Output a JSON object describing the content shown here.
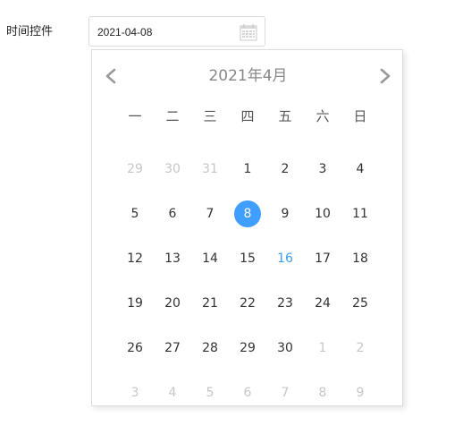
{
  "field": {
    "label": "时间控件",
    "value": "2021-04-08",
    "icon": "calendar-icon"
  },
  "picker": {
    "title": "2021年4月",
    "prev_icon": "chevron-left-icon",
    "next_icon": "chevron-right-icon",
    "weekdays": [
      "一",
      "二",
      "三",
      "四",
      "五",
      "六",
      "日"
    ],
    "weeks": [
      [
        {
          "d": "29",
          "s": "other"
        },
        {
          "d": "30",
          "s": "other"
        },
        {
          "d": "31",
          "s": "other"
        },
        {
          "d": "1",
          "s": ""
        },
        {
          "d": "2",
          "s": ""
        },
        {
          "d": "3",
          "s": ""
        },
        {
          "d": "4",
          "s": ""
        }
      ],
      [
        {
          "d": "5",
          "s": ""
        },
        {
          "d": "6",
          "s": ""
        },
        {
          "d": "7",
          "s": ""
        },
        {
          "d": "8",
          "s": "selected"
        },
        {
          "d": "9",
          "s": ""
        },
        {
          "d": "10",
          "s": ""
        },
        {
          "d": "11",
          "s": ""
        }
      ],
      [
        {
          "d": "12",
          "s": ""
        },
        {
          "d": "13",
          "s": ""
        },
        {
          "d": "14",
          "s": ""
        },
        {
          "d": "15",
          "s": ""
        },
        {
          "d": "16",
          "s": "today"
        },
        {
          "d": "17",
          "s": ""
        },
        {
          "d": "18",
          "s": ""
        }
      ],
      [
        {
          "d": "19",
          "s": ""
        },
        {
          "d": "20",
          "s": ""
        },
        {
          "d": "21",
          "s": ""
        },
        {
          "d": "22",
          "s": ""
        },
        {
          "d": "23",
          "s": ""
        },
        {
          "d": "24",
          "s": ""
        },
        {
          "d": "25",
          "s": ""
        }
      ],
      [
        {
          "d": "26",
          "s": ""
        },
        {
          "d": "27",
          "s": ""
        },
        {
          "d": "28",
          "s": ""
        },
        {
          "d": "29",
          "s": ""
        },
        {
          "d": "30",
          "s": ""
        },
        {
          "d": "1",
          "s": "other"
        },
        {
          "d": "2",
          "s": "other"
        }
      ],
      [
        {
          "d": "3",
          "s": "other"
        },
        {
          "d": "4",
          "s": "other"
        },
        {
          "d": "5",
          "s": "other"
        },
        {
          "d": "6",
          "s": "other"
        },
        {
          "d": "7",
          "s": "other"
        },
        {
          "d": "8",
          "s": "other"
        },
        {
          "d": "9",
          "s": "other"
        }
      ]
    ]
  },
  "colors": {
    "selected": "#409eff",
    "today": "#3a9fef",
    "other_month": "#c6c6c6",
    "arrow": "#999999"
  }
}
